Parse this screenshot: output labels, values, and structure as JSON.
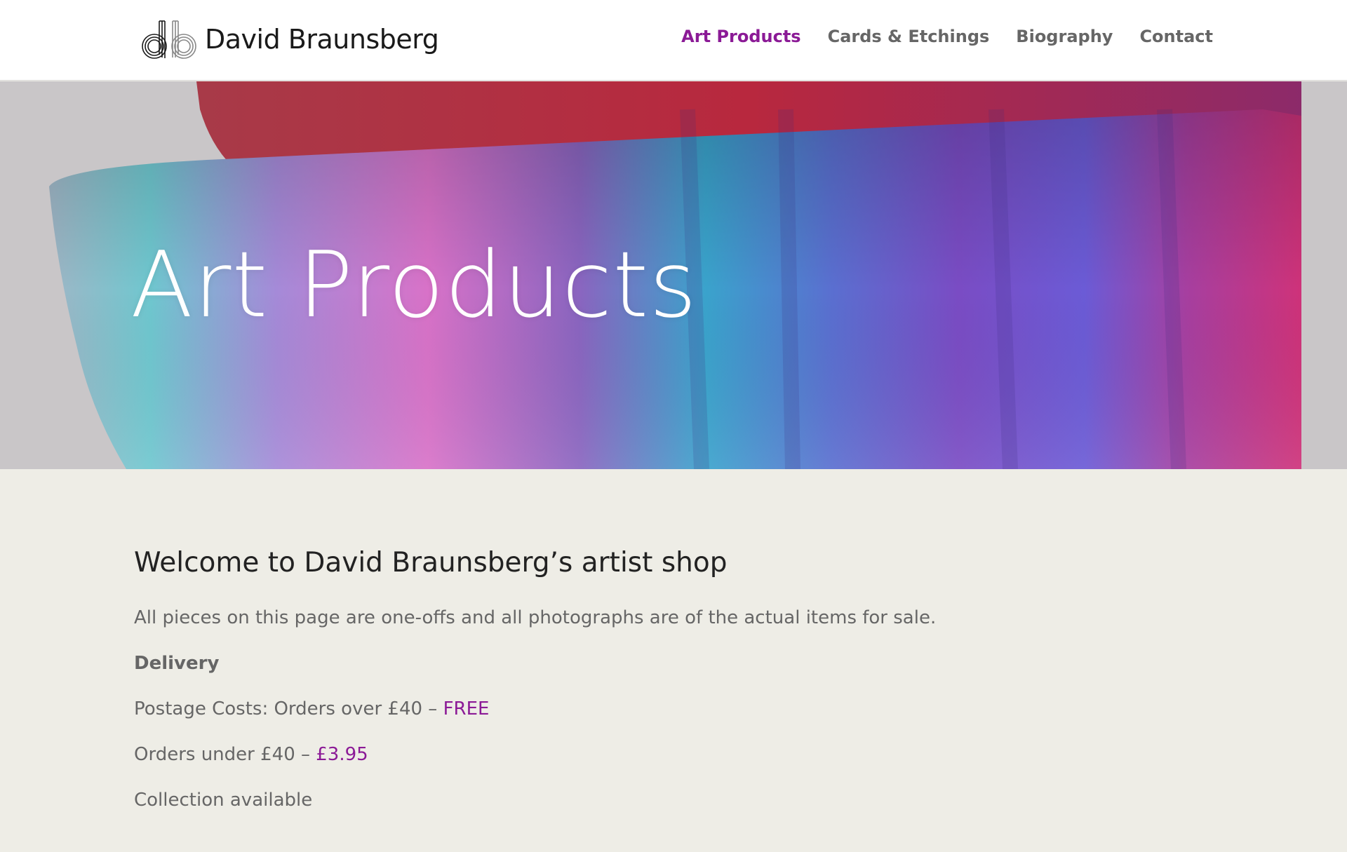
{
  "brand": {
    "name": "David Braunsberg",
    "accent_color": "#8b1a96"
  },
  "nav": {
    "items": [
      {
        "label": "Art Products",
        "active": true
      },
      {
        "label": "Cards & Etchings",
        "active": false
      },
      {
        "label": "Biography",
        "active": false
      },
      {
        "label": "Contact",
        "active": false
      }
    ]
  },
  "hero": {
    "title": "Art Products"
  },
  "content": {
    "heading": "Welcome to David Braunsberg’s artist shop",
    "intro": "All pieces on this page are one-offs and all photographs are of the actual items for sale.",
    "delivery_heading": "Delivery",
    "postage_prefix": "Postage Costs:  Orders over £40 – ",
    "postage_value": "FREE",
    "under_prefix": "Orders under £40 – ",
    "under_value": "£3.95",
    "collection": "Collection available"
  }
}
